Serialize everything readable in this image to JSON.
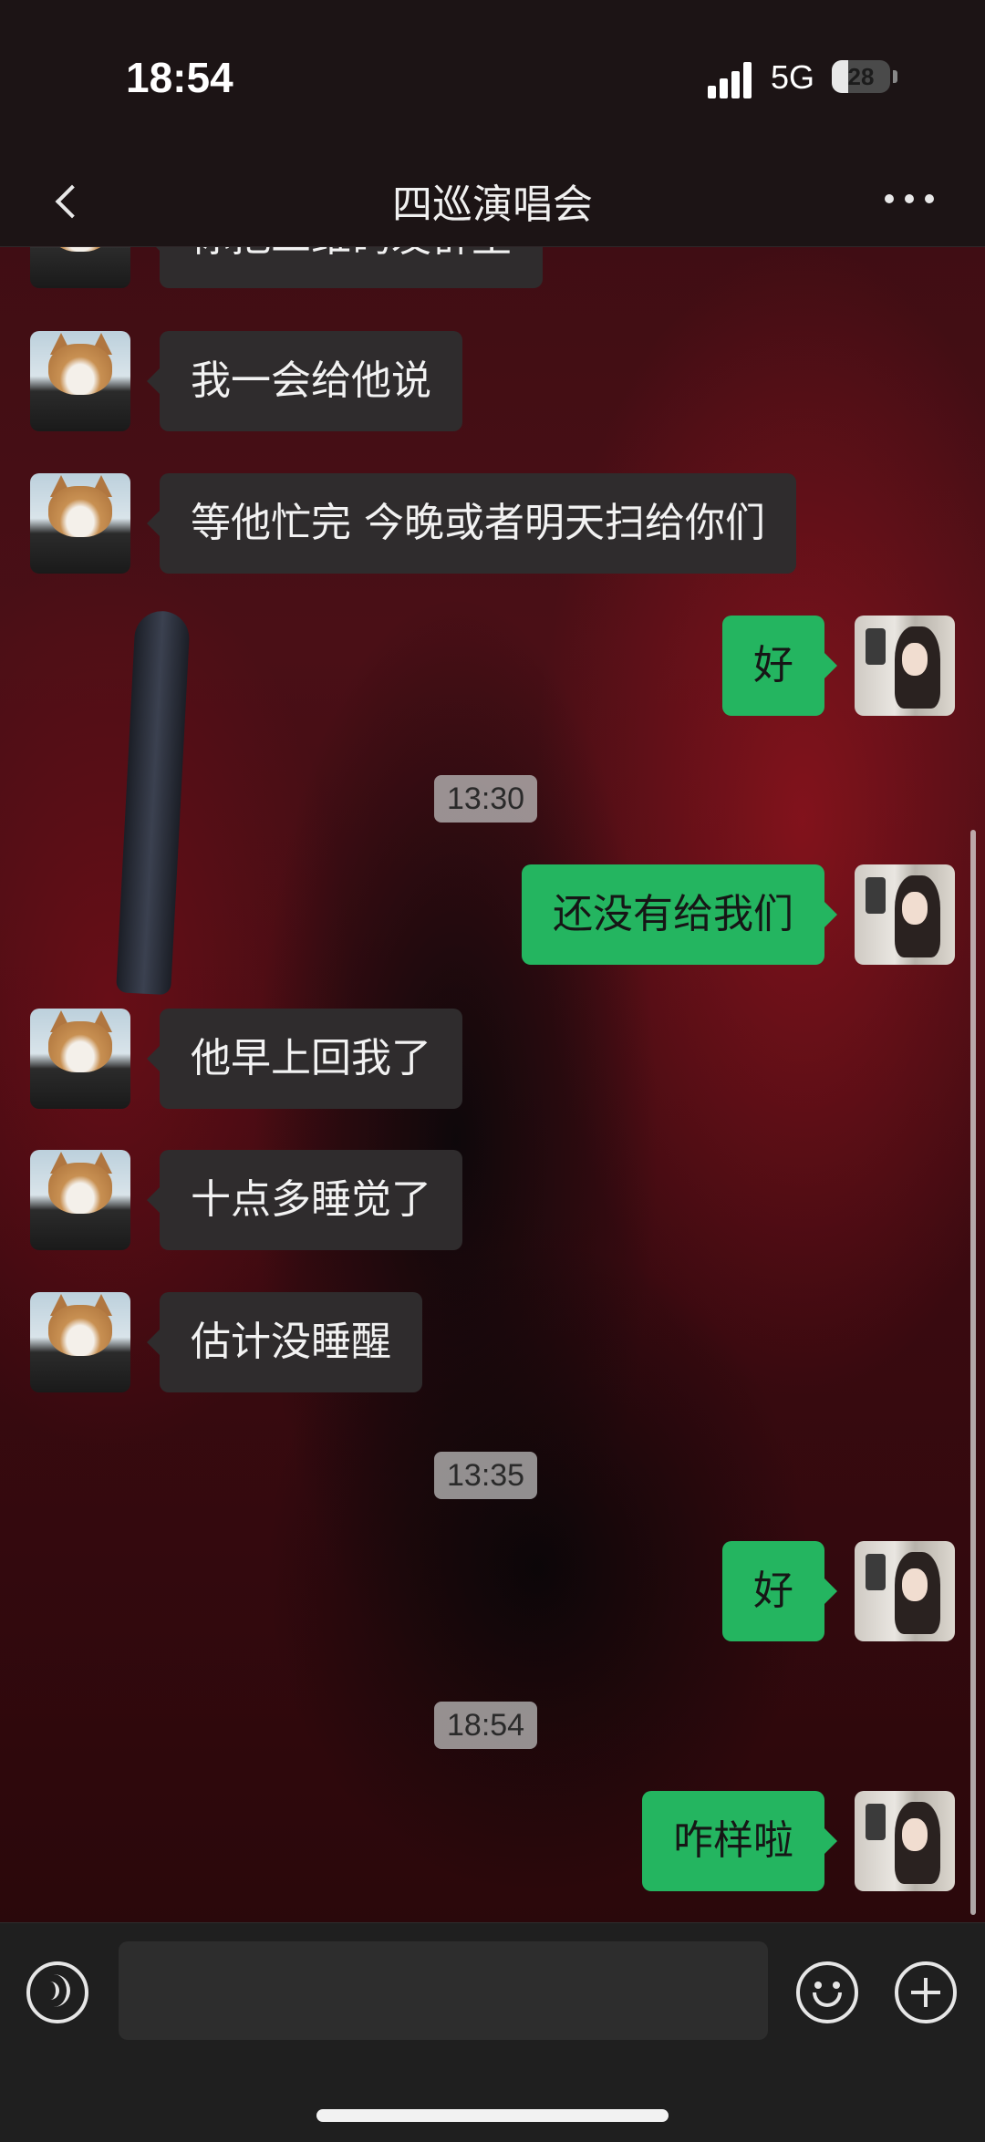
{
  "status_bar": {
    "time": "18:54",
    "network": "5G",
    "battery": "28",
    "battery_level_percent": 28
  },
  "nav": {
    "title": "四巡演唱会",
    "back_icon": "chevron-left-icon",
    "more_icon": "more-dots-icon"
  },
  "messages": [
    {
      "side": "in",
      "text": "你把二维码发群里",
      "note_partially_visible": true
    },
    {
      "side": "in",
      "text": "我一会给他说"
    },
    {
      "side": "in",
      "text": "等他忙完 今晚或者明天扫给你们"
    },
    {
      "side": "out",
      "text": "好"
    },
    {
      "type": "time",
      "text": "13:30"
    },
    {
      "side": "out",
      "text": "还没有给我们"
    },
    {
      "side": "in",
      "text": "他早上回我了"
    },
    {
      "side": "in",
      "text": "十点多睡觉了"
    },
    {
      "side": "in",
      "text": "估计没睡醒"
    },
    {
      "type": "time",
      "text": "13:35"
    },
    {
      "side": "out",
      "text": "好"
    },
    {
      "type": "time",
      "text": "18:54"
    },
    {
      "side": "out",
      "text": "咋样啦"
    }
  ],
  "input_bar": {
    "voice_icon": "voice-icon",
    "input_value": "",
    "emoji_icon": "emoji-icon",
    "plus_icon": "plus-icon"
  },
  "colors": {
    "outgoing_bubble": "#24b560",
    "incoming_bubble": "#2f2c2d",
    "bar_background": "#1c1415"
  }
}
